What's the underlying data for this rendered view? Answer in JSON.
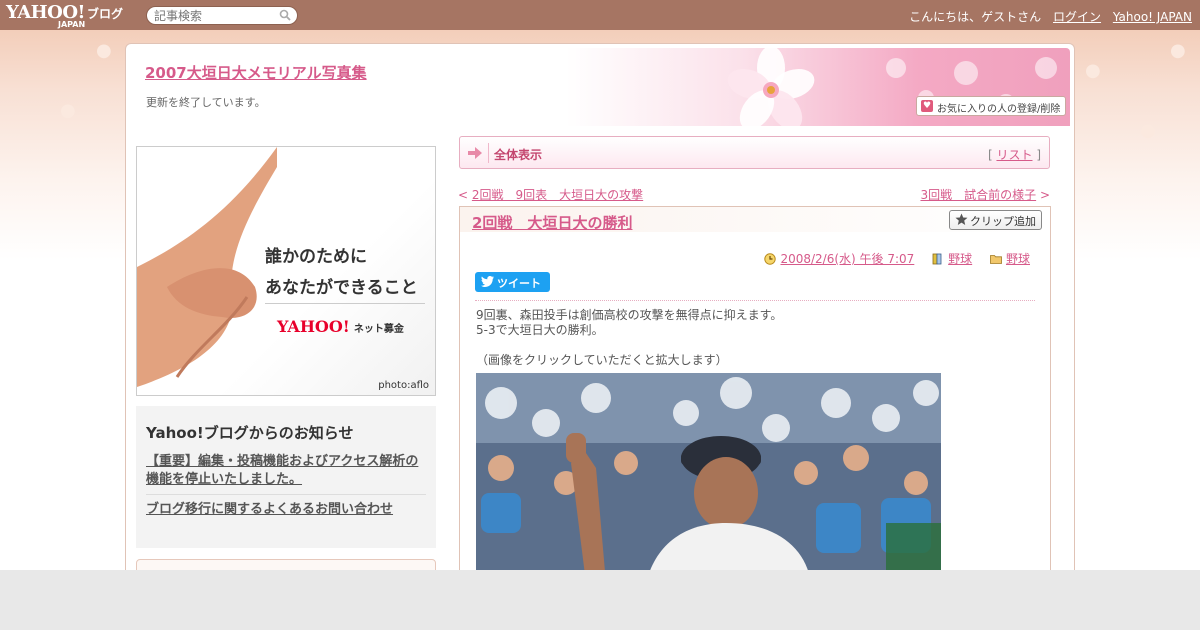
{
  "topbar": {
    "logo_main": "YAHOO!",
    "logo_sub": "JAPAN",
    "logo_blog": "ブログ",
    "search_placeholder": "記事検索",
    "greeting": "こんにちは、ゲストさん",
    "login": "ログイン",
    "yahoo_japan": "Yahoo! JAPAN"
  },
  "header": {
    "blog_title": "2007大垣日大メモリアル写真集",
    "blog_desc": "更新を終了しています。",
    "favorite_button": "お気に入りの人の登録/削除"
  },
  "ad": {
    "line1": "誰かのために",
    "line2": "あなたができること",
    "logo": "YAHOO!",
    "logo_sub": "JAPAN",
    "logo_label": "ネット募金",
    "credit": "photo:aflo"
  },
  "notice": {
    "title": "Yahoo!ブログからのお知らせ",
    "items": [
      "【重要】編集・投稿機能およびアクセス解析の機能を停止いたしました。",
      "ブログ移行に関するよくあるお問い合わせ"
    ]
  },
  "nav": {
    "label": "全体表示",
    "list_open": "[",
    "list_link": "リスト",
    "list_close": "]"
  },
  "pager": {
    "prev_mark": "<",
    "prev": "2回戦　9回表　大垣日大の攻撃",
    "next": "3回戦　試合前の様子",
    "next_mark": ">"
  },
  "article": {
    "title": "2回戦　大垣日大の勝利",
    "clip_button": "クリップ追加",
    "date": "2008/2/6(水) 午後 7:07",
    "category1": "野球",
    "category2": "野球",
    "tweet": "ツイート",
    "body_line1": "9回裏、森田投手は創価高校の攻撃を無得点に抑えます。",
    "body_line2": "5-3で大垣日大の勝利。",
    "body_line3": "（画像をクリックしていただくと拡大します）"
  },
  "colors": {
    "topbar": "#a67563",
    "accent_pink": "#d65a8a",
    "twitter": "#1da1f2"
  },
  "icons": [
    "search-icon",
    "heart-icon",
    "arrow-right-icon",
    "star-icon",
    "clock-icon",
    "book-icon",
    "folder-icon",
    "twitter-bird-icon"
  ]
}
